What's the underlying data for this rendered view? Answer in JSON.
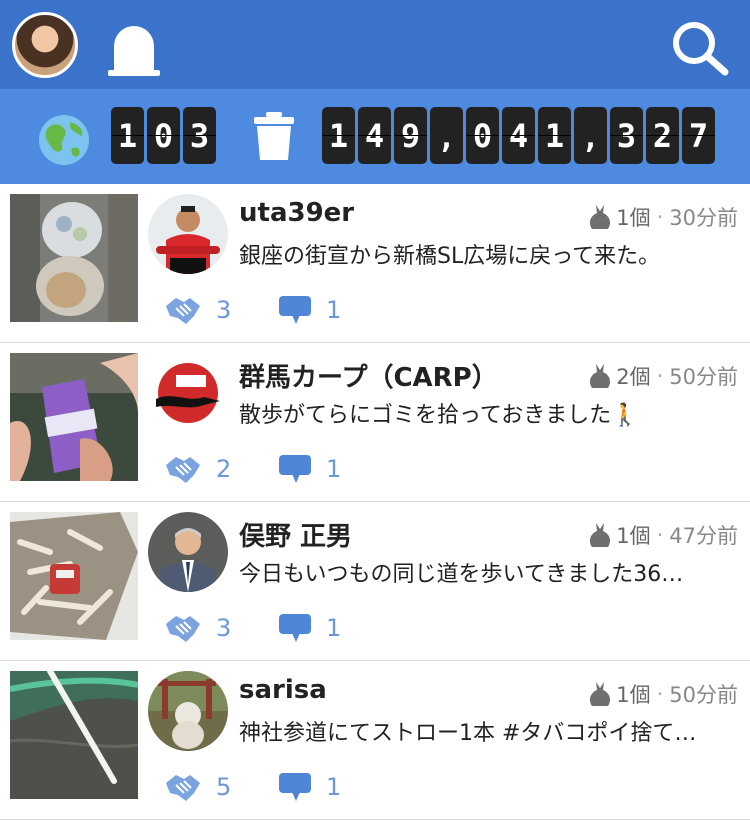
{
  "header": {
    "profile_avatar": "avatar",
    "icons": [
      "tombstone-icon",
      "search-icon"
    ]
  },
  "stats": {
    "icons": [
      "globe-icon",
      "trash-icon"
    ],
    "people_digits": [
      "1",
      "0",
      "3"
    ],
    "trash_digits": [
      "1",
      "4",
      "9",
      ",",
      "0",
      "4",
      "1",
      ",",
      "3",
      "2",
      "7"
    ]
  },
  "posts": [
    {
      "username": "uta39er",
      "bags": "1個",
      "time": "30分前",
      "message": "銀座の街宣から新橋SL広場に戻って来た。",
      "thanks": "3",
      "comments": "1"
    },
    {
      "username": "群馬カープ（CARP）",
      "bags": "2個",
      "time": "50分前",
      "message": "散歩がてらにゴミを拾っておきました🚶",
      "thanks": "2",
      "comments": "1"
    },
    {
      "username": "俣野 正男",
      "bags": "1個",
      "time": "47分前",
      "message": "今日もいつもの同じ道を歩いてきました36…",
      "thanks": "3",
      "comments": "1"
    },
    {
      "username": "sarisa",
      "bags": "1個",
      "time": "50分前",
      "message": "神社参道にてストロー1本 #タバコポイ捨て…",
      "thanks": "5",
      "comments": "1"
    }
  ],
  "colors": {
    "header": "#3a73c9",
    "stats_bar": "#4d8ae0",
    "action_blue": "#6b98d8"
  }
}
